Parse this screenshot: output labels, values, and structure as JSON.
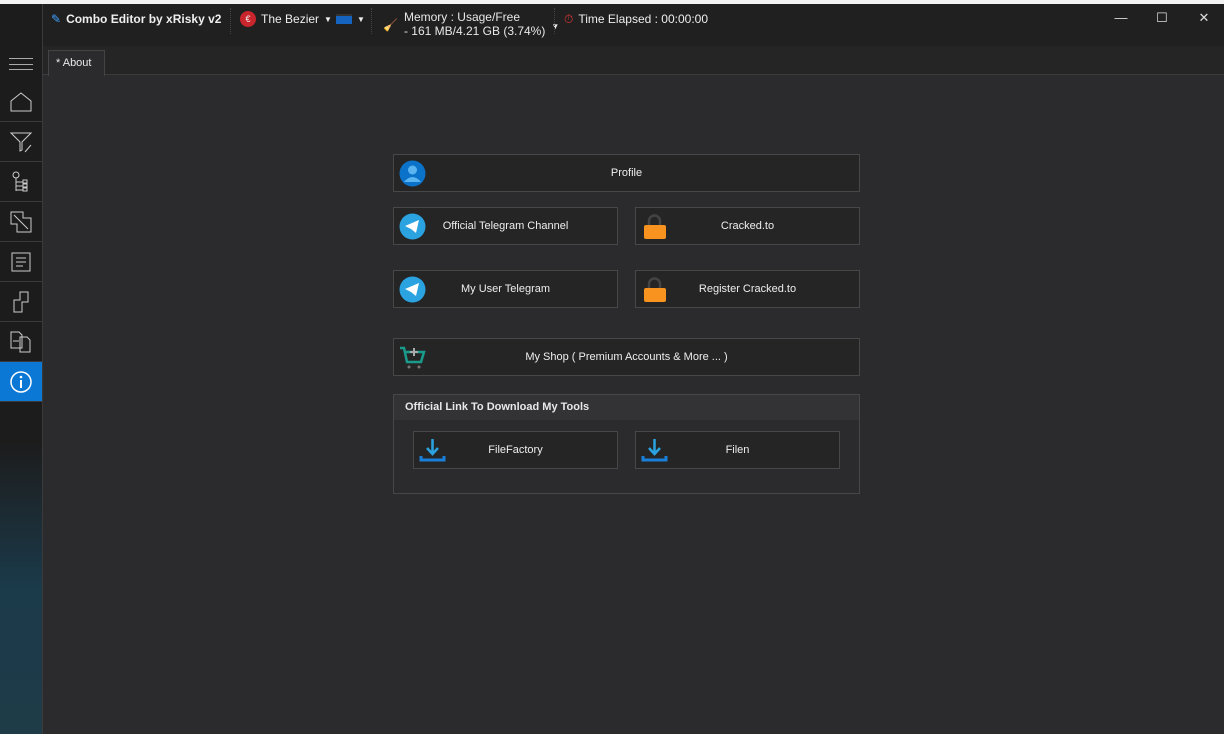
{
  "window": {
    "title": "Combo Editor by xRisky v2",
    "theme": "The Bezier",
    "memory_label": "Memory : Usage/Free",
    "memory_value": "- 161 MB/4.21 GB (3.74%)",
    "time_elapsed": "Time Elapsed : 00:00:00"
  },
  "sidebar": {
    "items": [
      {
        "icon": "home-icon"
      },
      {
        "icon": "filter-edit-icon"
      },
      {
        "icon": "tree-icon"
      },
      {
        "icon": "resize-icon"
      },
      {
        "icon": "sort-lines-icon"
      },
      {
        "icon": "split-file-icon"
      },
      {
        "icon": "merge-files-icon"
      },
      {
        "icon": "info-icon",
        "selected": true
      }
    ]
  },
  "tabs": [
    {
      "label": "* About"
    }
  ],
  "buttons": {
    "profile": "Profile",
    "telegram_channel": "Official Telegram Channel",
    "cracked": "Cracked.to",
    "user_telegram": "My User Telegram",
    "register_cracked": "Register Cracked.to",
    "shop": "My Shop ( Premium Accounts & More ...  )"
  },
  "download_group": {
    "title": "Official Link To Download My Tools",
    "filefactory": "FileFactory",
    "filen": "Filen"
  },
  "colors": {
    "accent": "#0a78d4",
    "lock": "#f7931e",
    "telegram": "#2aa3e0",
    "cart": "#1a9c8c"
  }
}
